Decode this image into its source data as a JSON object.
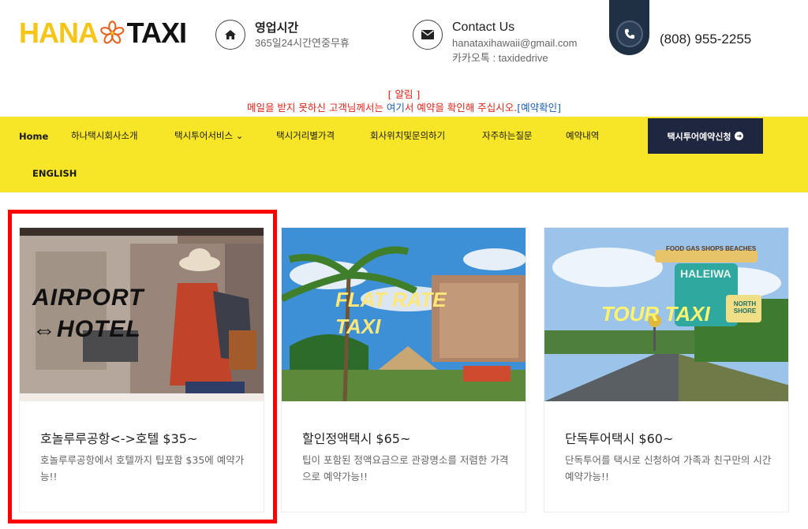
{
  "header": {
    "logo_left": "HANA",
    "logo_right": "TAXI",
    "hours_title": "영업시간",
    "hours_sub": "365일24시간연중무휴",
    "contact_title": "Contact Us",
    "contact_email": "hanataxihawaii@gmail.com",
    "contact_kakao": "카카오톡 : taxidedrive",
    "phone": "(808) 955-2255"
  },
  "notice": {
    "line1": "[ 알림 ]",
    "line2_before": "메일을 받지 못하신 고객님께서는 ",
    "line2_link": "여기",
    "line2_after": "서 예약을 확인해 주십시오.",
    "line2_bracket_link": "[예약확인]"
  },
  "nav": {
    "items": [
      "Home",
      "하나택시회사소개",
      "택시투어서비스 ⌄",
      "택시거리별가격",
      "회사위치및문의하기",
      "자주하는질문",
      "예약내역",
      "ENGLISH"
    ],
    "cta": "택시투어예약신청"
  },
  "cards": [
    {
      "image_text_1": "AIRPORT",
      "image_text_2": "⇔HOTEL",
      "title": "호놀루루공항<->호텔 $35~",
      "desc": "호놀루루공항에서 호텔까지 팁포함 $35에 예약가능!!"
    },
    {
      "image_text_1": "FLAT RATE",
      "image_text_2": "TAXI",
      "title": "할인정액택시 $65~",
      "desc": "팁이 포함된 정액요금으로 관광명소를 저렴한 가격으로 예약가능!!"
    },
    {
      "image_text_1": "TOUR TAXI",
      "image_sign_1": "FOOD GAS SHOPS BEACHES",
      "image_sign_2": "HALEIWA",
      "image_sign_3": "NORTH SHORE",
      "title": "단독투어택시 $60~",
      "desc": "단독투어를 택시로 신청하여 가족과 친구만의 시간 예약가능!!"
    }
  ],
  "colors": {
    "nav_bg": "#f7e528",
    "cta_bg": "#1f2640",
    "notice_red": "#e0251b",
    "notice_blue": "#1a5fb4",
    "highlight": "#ff0000"
  }
}
